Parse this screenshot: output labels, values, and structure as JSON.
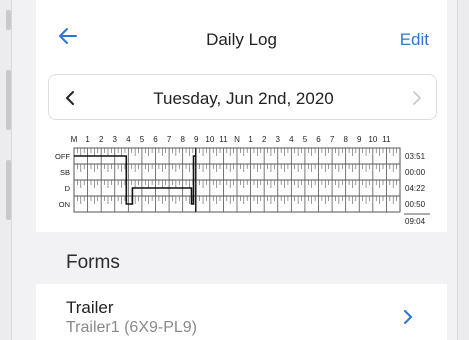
{
  "nav": {
    "title": "Daily Log",
    "edit_label": "Edit"
  },
  "date_bar": {
    "date": "Tuesday, Jun 2nd, 2020"
  },
  "log_chart": {
    "hour_labels": [
      "M",
      "1",
      "2",
      "3",
      "4",
      "5",
      "6",
      "7",
      "8",
      "9",
      "10",
      "11",
      "N",
      "1",
      "2",
      "3",
      "4",
      "5",
      "6",
      "7",
      "8",
      "9",
      "10",
      "11"
    ],
    "status_labels": [
      "OFF",
      "SB",
      "D",
      "ON"
    ],
    "totals": [
      "03:51",
      "00:00",
      "04:22",
      "00:50"
    ],
    "grand_total": "09:04",
    "timeline": [
      {
        "status": "OFF",
        "start_hour": 0,
        "end_hour": 3.85
      },
      {
        "status": "ON",
        "start_hour": 3.85,
        "end_hour": 4.3
      },
      {
        "status": "D",
        "start_hour": 4.3,
        "end_hour": 8.65
      },
      {
        "status": "ON",
        "start_hour": 8.65,
        "end_hour": 8.8
      },
      {
        "status": "OFF",
        "start_hour": 8.8,
        "end_hour": 8.95
      }
    ],
    "colors": {
      "grid": "#555555",
      "line": "#111111"
    }
  },
  "forms": {
    "heading": "Forms",
    "items": [
      {
        "title": "Trailer",
        "subtitle": "Trailer1 (6X9-PL9)"
      }
    ]
  },
  "icons": [
    "back-arrow-icon",
    "chevron-left-icon",
    "chevron-right-icon"
  ],
  "colors": {
    "accent": "#2f74d0",
    "background": "#f2f2f4"
  }
}
